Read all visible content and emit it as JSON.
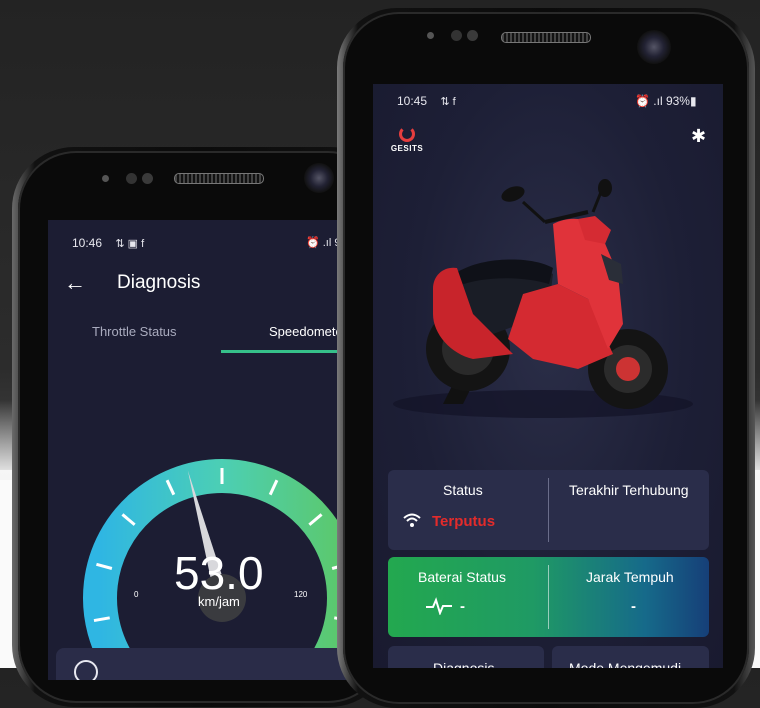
{
  "left_phone": {
    "status_time": "10:46",
    "status_icons_left": "⇅ ▣ f",
    "status_icons_right": "⏰ .ıl 9",
    "title": "Diagnosis",
    "tabs": [
      {
        "label": "Throttle Status",
        "active": false
      },
      {
        "label": "Speedometer",
        "active": true
      }
    ],
    "speed_value": "53.0",
    "speed_unit": "km/jam",
    "gauge_min": "0",
    "gauge_max": "120",
    "gauge_fraction": 0.44,
    "colors": {
      "accent": "#36c08a",
      "background": "#1c1d33"
    }
  },
  "right_phone": {
    "status_time": "10:45",
    "status_icons_left": "⇅ f",
    "status_icons_right": "⏰ .ıl 93%▮",
    "brand": "GESITS",
    "status_card": {
      "label": "Status",
      "value": "Terputus",
      "right_label": "Terakhir Terhubung"
    },
    "battery_card": {
      "label": "Baterai Status",
      "value": "-",
      "right_label": "Jarak Tempuh",
      "right_value": "-"
    },
    "bottom_cards": [
      {
        "label": "Diagnosis"
      },
      {
        "label": "Mode Mengemudi"
      }
    ],
    "colors": {
      "disconnected": "#e32b2b",
      "battery_green": "#23a84f",
      "battery_blue": "#163f78"
    }
  }
}
